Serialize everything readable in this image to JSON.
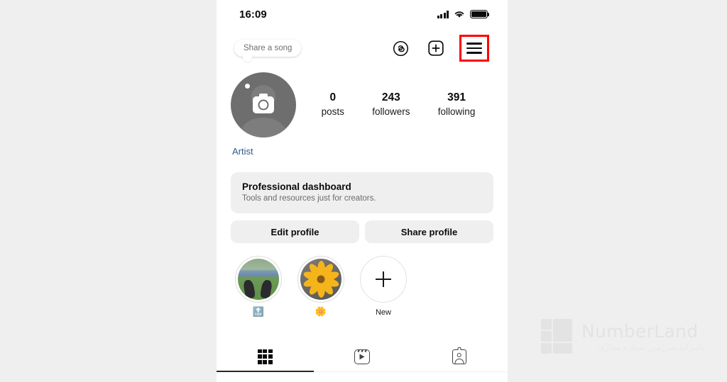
{
  "status_bar": {
    "time": "16:09",
    "signal_icon": "cellular-signal-icon",
    "wifi_icon": "wifi-icon",
    "battery_icon": "battery-full-icon"
  },
  "top_actions": {
    "threads_label": "Threads",
    "add_label": "New post",
    "menu_label": "Menu",
    "highlight_color": "#ff0000"
  },
  "profile": {
    "avatar_alt": "Profile photo placeholder",
    "share_song_label": "Share a song",
    "category": "Artist",
    "category_color": "#2d5b8e",
    "stats": [
      {
        "num": "0",
        "label": "posts"
      },
      {
        "num": "243",
        "label": "followers"
      },
      {
        "num": "391",
        "label": "following"
      }
    ]
  },
  "dashboard": {
    "title": "Professional dashboard",
    "subtitle": "Tools and resources just for creators."
  },
  "actions": {
    "edit_profile": "Edit profile",
    "share_profile": "Share profile"
  },
  "highlights": [
    {
      "label": "",
      "emoji": "🔝",
      "kind": "feet"
    },
    {
      "label": "",
      "emoji": "🌼",
      "kind": "flower"
    },
    {
      "label": "New",
      "emoji": "",
      "kind": "new"
    }
  ],
  "tabs": [
    {
      "name": "grid",
      "label": "Posts grid",
      "active": true
    },
    {
      "name": "reels",
      "label": "Reels",
      "active": false
    },
    {
      "name": "tagged",
      "label": "Tagged",
      "active": false
    }
  ],
  "watermark": {
    "name": "NumberLand",
    "tagline": "نامبرلند سرزمین شماره مجازی"
  }
}
